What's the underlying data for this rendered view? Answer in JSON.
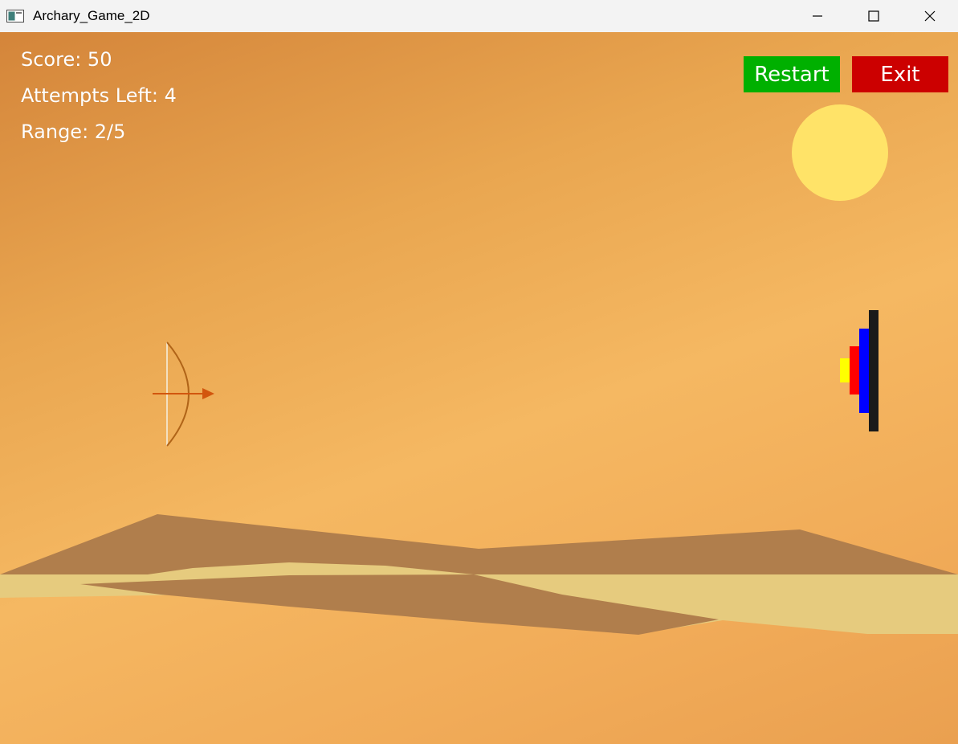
{
  "window": {
    "title": "Archary_Game_2D",
    "icon": "app-window-icon",
    "controls": [
      "minimize-icon",
      "maximize-icon",
      "close-icon"
    ]
  },
  "hud": {
    "score": "Score: 50",
    "attempts": "Attempts Left: 4",
    "range": "Range: 2/5"
  },
  "buttons": {
    "restart": "Restart",
    "exit": "Exit"
  },
  "colors": {
    "restart": "#00b000",
    "exit": "#cc0000",
    "sun": "#ffe368",
    "dunes": "#b07e4c",
    "sand_band": "#e6cb7e",
    "target_outer": "#1a1a1a",
    "target_blue": "#0000ff",
    "target_red": "#ff0000",
    "target_yellow": "#ffff00",
    "arrow": "#d2560e",
    "bow": "#b06418"
  }
}
